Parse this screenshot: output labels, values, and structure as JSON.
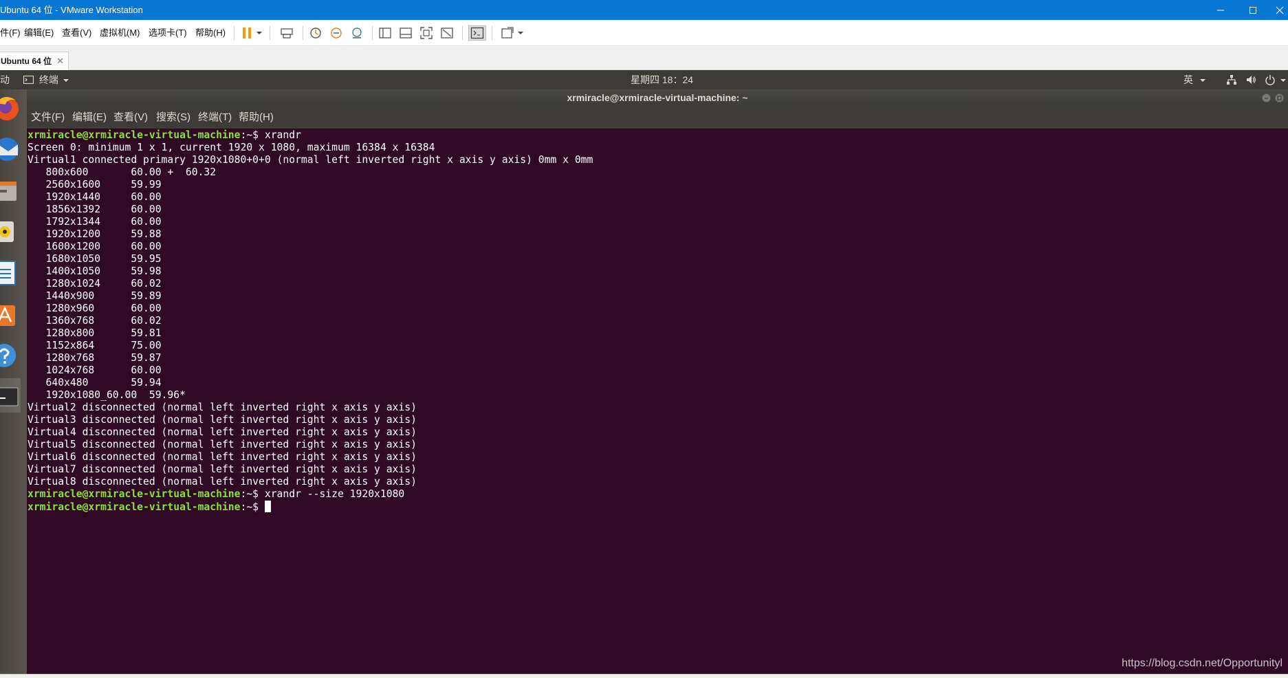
{
  "vmware": {
    "title": "Ubuntu 64 位 - VMware Workstation",
    "menu": [
      "件(F)",
      "编辑(E)",
      "查看(V)",
      "虚拟机(M)",
      "选项卡(T)",
      "帮助(H)"
    ],
    "tab_label": "Ubuntu 64 位",
    "tab_close": "✕"
  },
  "ubuntu_panel": {
    "activities": "动",
    "app_menu": "终端",
    "clock": "星期四 18：24",
    "input_method": "英"
  },
  "terminal": {
    "window_title": "xrmiracle@xrmiracle-virtual-machine: ~",
    "menu": [
      "文件(F)",
      "编辑(E)",
      "查看(V)",
      "搜索(S)",
      "终端(T)",
      "帮助(H)"
    ],
    "prompt": "xrmiracle@xrmiracle-virtual-machine",
    "prompt_suffix": ":~$ ",
    "command1": "xrandr",
    "output": [
      "Screen 0: minimum 1 x 1, current 1920 x 1080, maximum 16384 x 16384",
      "Virtual1 connected primary 1920x1080+0+0 (normal left inverted right x axis y axis) 0mm x 0mm",
      "   800x600       60.00 +  60.32",
      "   2560x1600     59.99",
      "   1920x1440     60.00",
      "   1856x1392     60.00",
      "   1792x1344     60.00",
      "   1920x1200     59.88",
      "   1600x1200     60.00",
      "   1680x1050     59.95",
      "   1400x1050     59.98",
      "   1280x1024     60.02",
      "   1440x900      59.89",
      "   1280x960      60.00",
      "   1360x768      60.02",
      "   1280x800      59.81",
      "   1152x864      75.00",
      "   1280x768      59.87",
      "   1024x768      60.00",
      "   640x480       59.94",
      "   1920x1080_60.00  59.96*",
      "Virtual2 disconnected (normal left inverted right x axis y axis)",
      "Virtual3 disconnected (normal left inverted right x axis y axis)",
      "Virtual4 disconnected (normal left inverted right x axis y axis)",
      "Virtual5 disconnected (normal left inverted right x axis y axis)",
      "Virtual6 disconnected (normal left inverted right x axis y axis)",
      "Virtual7 disconnected (normal left inverted right x axis y axis)",
      "Virtual8 disconnected (normal left inverted right x axis y axis)"
    ],
    "command2": "xrandr --size 1920x1080"
  },
  "watermark": "https://blog.csdn.net/Opportunityl",
  "colors": {
    "vmware_titlebar": "#0a77d5",
    "terminal_bg": "#300a24",
    "prompt": "#8ae234",
    "ubuntu_panel": "#3c3b37"
  }
}
